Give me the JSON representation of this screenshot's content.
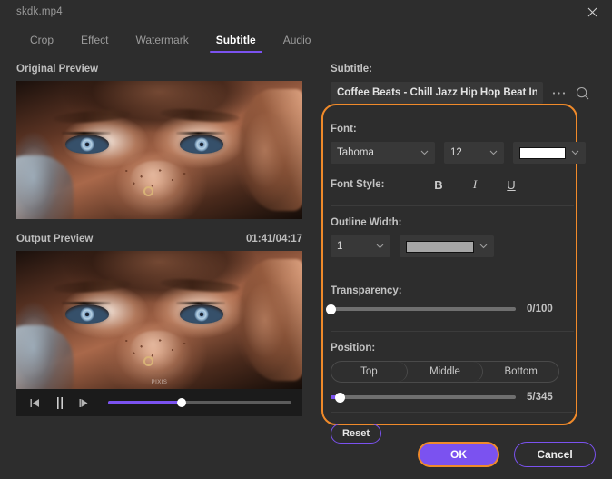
{
  "window": {
    "title": "skdk.mp4",
    "close_icon": "close-icon"
  },
  "tabs": [
    {
      "label": "Crop",
      "active": false
    },
    {
      "label": "Effect",
      "active": false
    },
    {
      "label": "Watermark",
      "active": false
    },
    {
      "label": "Subtitle",
      "active": true
    },
    {
      "label": "Audio",
      "active": false
    }
  ],
  "preview": {
    "original_label": "Original Preview",
    "output_label": "Output Preview",
    "timecode": "01:41/04:17",
    "watermark_text": "PIXIS",
    "player": {
      "prev_frame_icon": "previous-frame-icon",
      "pause_icon": "pause-icon",
      "next_frame_icon": "next-frame-icon",
      "progress_percent": 40
    }
  },
  "subtitle": {
    "label": "Subtitle:",
    "value": "Coffee Beats - Chill Jazz Hip Hop Beat Instru",
    "placeholder": "Coffee Beats - Chill Jazz Hip Hop Beat Instru",
    "more_icon": "ellipsis-icon",
    "search_icon": "search-icon"
  },
  "font": {
    "label": "Font:",
    "family": "Tahoma",
    "size": "12",
    "color_hex": "#ffffff"
  },
  "font_style": {
    "label": "Font Style:",
    "bold_label": "B",
    "italic_label": "I",
    "underline_label": "U"
  },
  "outline": {
    "label": "Outline Width:",
    "width": "1",
    "color_hex": "#a6a6a6"
  },
  "transparency": {
    "label": "Transparency:",
    "value_text": "0/100",
    "percent": 0
  },
  "position": {
    "label": "Position:",
    "options": [
      "Top",
      "Middle",
      "Bottom"
    ],
    "offset_text": "5/345",
    "offset_percent": 5
  },
  "reset": {
    "label": "Reset"
  },
  "footer": {
    "ok_label": "OK",
    "cancel_label": "Cancel"
  },
  "colors": {
    "accent_purple": "#7b52f0",
    "highlight_orange": "#f08a2a",
    "panel_bg": "#2d2d2d",
    "input_bg": "#383838"
  }
}
